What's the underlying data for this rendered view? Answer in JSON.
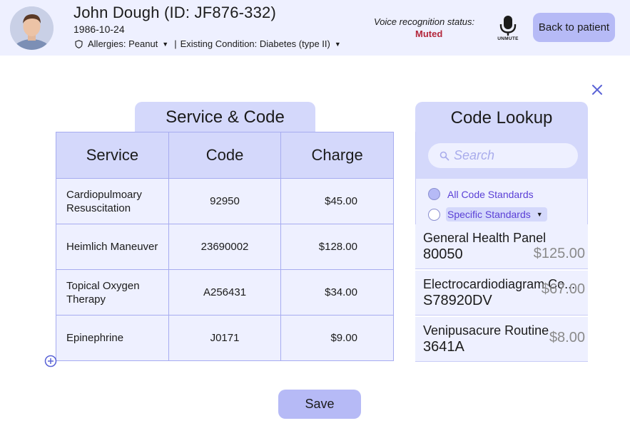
{
  "patient": {
    "name": "John Dough (ID: JF876-332)",
    "dob": "1986-10-24",
    "allergies": "Allergies: Peanut",
    "condition": "Existing Condition: Diabetes (type II)"
  },
  "voice": {
    "label": "Voice recognition status:",
    "status": "Muted",
    "mic_label": "UNMUTE"
  },
  "back_button": "Back to patient",
  "service_panel": {
    "title": "Service & Code",
    "columns": [
      "Service",
      "Code",
      "Charge"
    ],
    "rows": [
      {
        "service": "Cardiopulmoary Resuscitation",
        "code": "92950",
        "charge": "$45.00"
      },
      {
        "service": "Heimlich Maneuver",
        "code": "23690002",
        "charge": "$128.00"
      },
      {
        "service": "Topical Oxygen Therapy",
        "code": "A256431",
        "charge": "$34.00"
      },
      {
        "service": "Epinephrine",
        "code": "J0171",
        "charge": "$9.00"
      }
    ]
  },
  "lookup_panel": {
    "title": "Code Lookup",
    "search_placeholder": "Search",
    "options": [
      "All Code Standards",
      "Specific Standards"
    ],
    "results": [
      {
        "name": "General Health Panel",
        "code": "80050",
        "price": "$125.00"
      },
      {
        "name": "Electrocardiodiagram Co...",
        "code": "S78920DV",
        "price": "$67.00"
      },
      {
        "name": "Venipusacure Routine",
        "code": "3641A",
        "price": "$8.00"
      }
    ]
  },
  "save_button": "Save",
  "colors": {
    "header_bg": "#eef0ff",
    "panel_header": "#d4d8fb",
    "button": "#b6baf6",
    "muted_red": "#b3263b",
    "link_purple": "#5a3fd6"
  }
}
